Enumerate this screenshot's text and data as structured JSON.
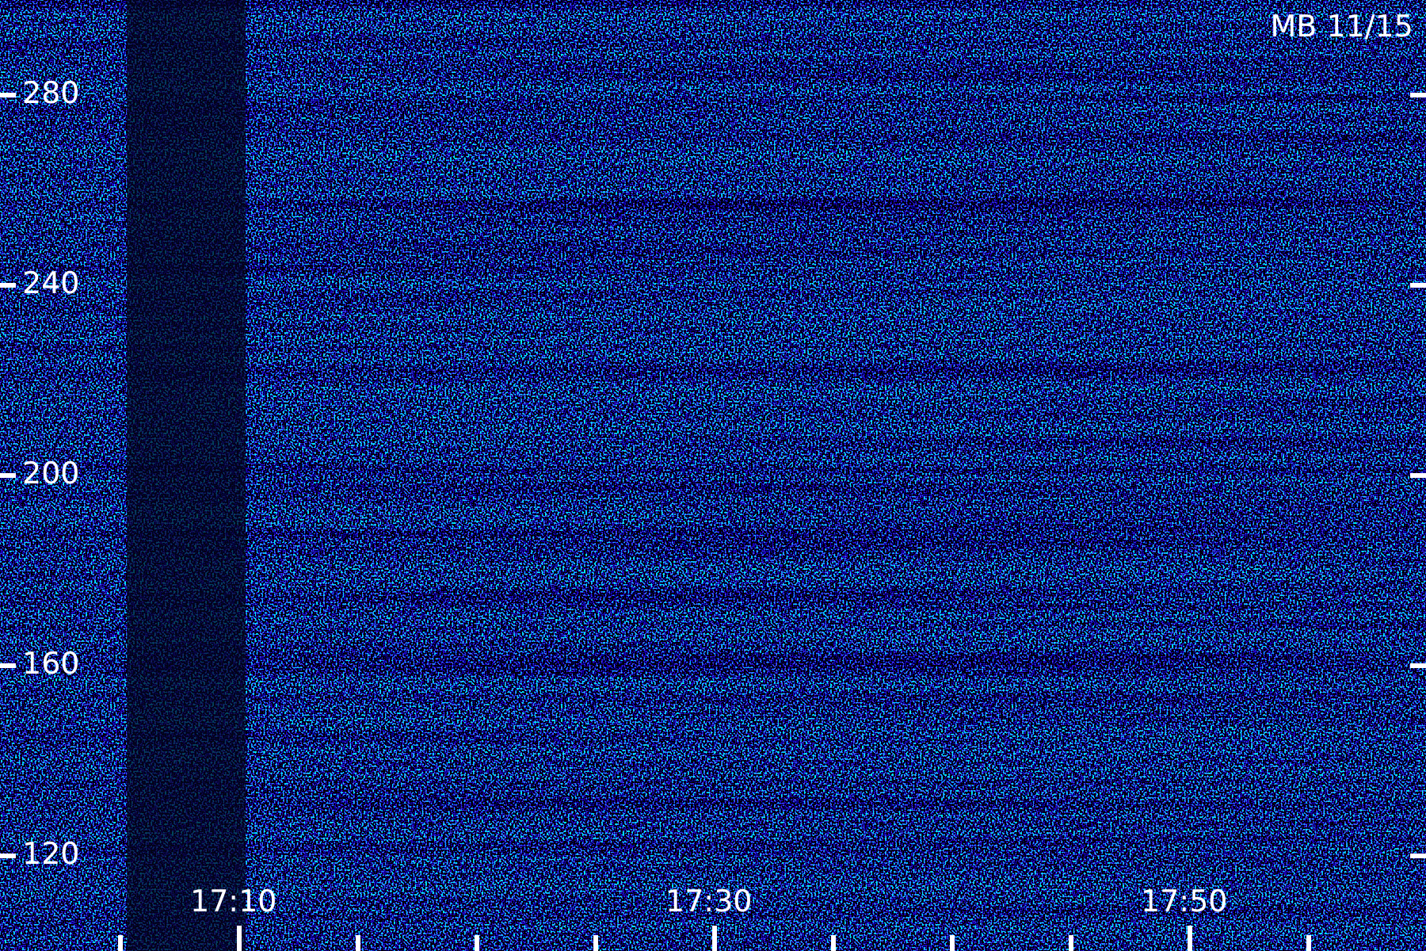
{
  "title": "MB 11/15",
  "y_axis": {
    "tick_labels": [
      "280",
      "240",
      "200",
      "160",
      "120"
    ]
  },
  "x_axis": {
    "tick_labels": [
      "17:10",
      "17:30",
      "17:50"
    ]
  }
}
